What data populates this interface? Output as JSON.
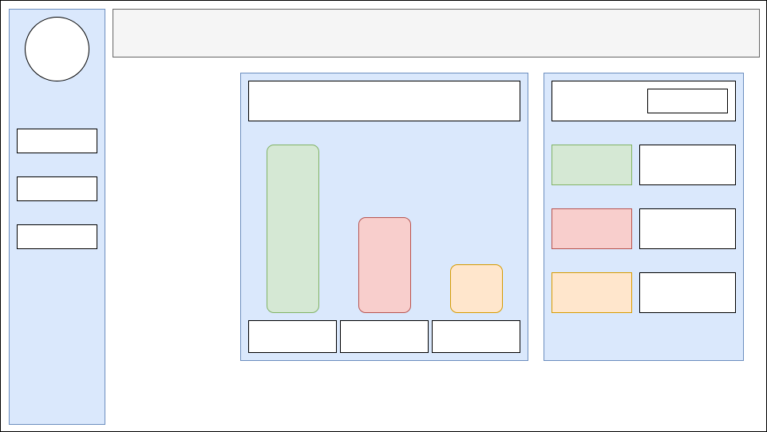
{
  "colors": {
    "panel_fill": "#dae8fc",
    "panel_stroke": "#6c8ebf",
    "header_fill": "#f5f5f5",
    "header_stroke": "#666666",
    "green_fill": "#d5e8d4",
    "green_stroke": "#82b366",
    "red_fill": "#f8cecc",
    "red_stroke": "#b85450",
    "orange_fill": "#ffe6cc",
    "orange_stroke": "#d79b00"
  },
  "sidebar": {
    "avatar": "",
    "nav_items": [
      {
        "label": ""
      },
      {
        "label": ""
      },
      {
        "label": ""
      }
    ]
  },
  "header": {
    "title": ""
  },
  "chart_card": {
    "title": "",
    "bars": [
      {
        "value": 100,
        "label": "",
        "fill": "#d5e8d4",
        "stroke": "#82b366"
      },
      {
        "value": 57,
        "label": "",
        "fill": "#f8cecc",
        "stroke": "#b85450"
      },
      {
        "value": 29,
        "label": "",
        "fill": "#ffe6cc",
        "stroke": "#d79b00"
      }
    ]
  },
  "legend_card": {
    "title": "",
    "button_label": "",
    "items": [
      {
        "swatch_fill": "#d5e8d4",
        "swatch_stroke": "#82b366",
        "label": ""
      },
      {
        "swatch_fill": "#f8cecc",
        "swatch_stroke": "#b85450",
        "label": ""
      },
      {
        "swatch_fill": "#ffe6cc",
        "swatch_stroke": "#d79b00",
        "label": ""
      }
    ]
  }
}
